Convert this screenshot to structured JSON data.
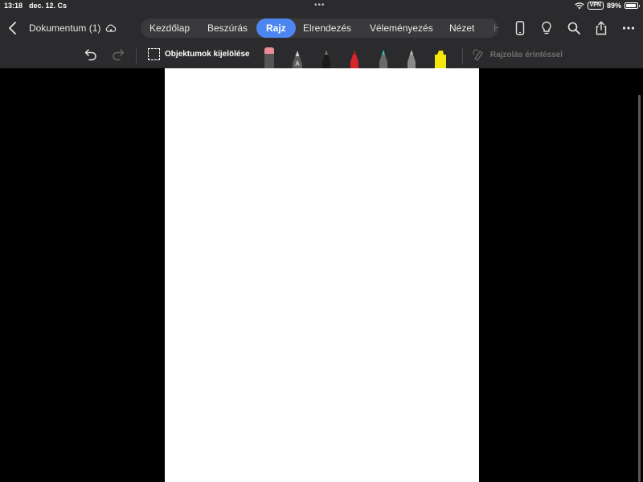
{
  "status": {
    "time": "13:18",
    "date": "dec. 12. Cs",
    "vpn": "VPN",
    "battery": "89%"
  },
  "header": {
    "doc_title": "Dokumentum (1)"
  },
  "tabs": [
    {
      "label": "Kezdőlap"
    },
    {
      "label": "Beszúrás"
    },
    {
      "label": "Rajz",
      "active": true
    },
    {
      "label": "Elrendezés"
    },
    {
      "label": "Véleményezés"
    },
    {
      "label": "Nézet"
    },
    {
      "label": "H"
    }
  ],
  "right_icons": [
    "phone-icon",
    "lightbulb-icon",
    "search-icon",
    "share-icon",
    "more-icon"
  ],
  "drawbar": {
    "select_label": "Objektumok kijelölése",
    "ink_label": "Rajzolás érintéssel",
    "tools": [
      {
        "name": "eraser",
        "color": "#f08a98"
      },
      {
        "name": "lasso-pen",
        "color": "#3a3a3a"
      },
      {
        "name": "pen-black",
        "color": "#111111"
      },
      {
        "name": "pen-red",
        "color": "#d7262b"
      },
      {
        "name": "pen-teal",
        "color": "#2fc2b5"
      },
      {
        "name": "pen-gray",
        "color": "#8a8a8a"
      },
      {
        "name": "highlighter-yellow",
        "color": "#f5e60b"
      }
    ]
  },
  "colors": {
    "toolbar_bg": "#2b2b2d",
    "accent": "#4d86f1",
    "canvas_bg": "#000000",
    "page_bg": "#ffffff"
  }
}
